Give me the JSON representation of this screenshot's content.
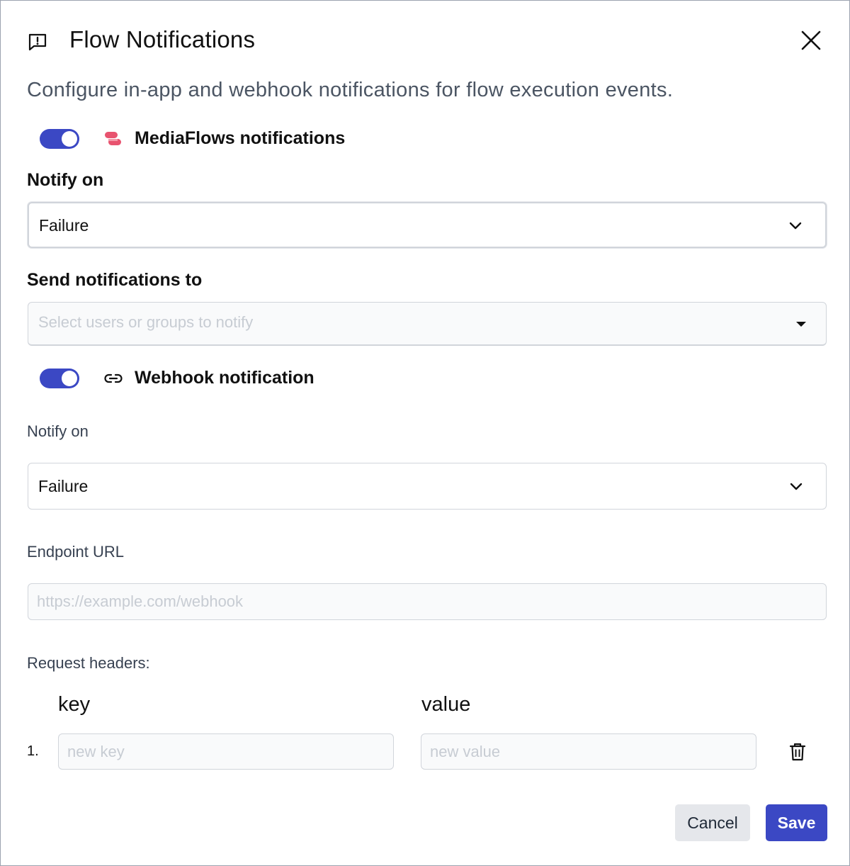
{
  "dialog": {
    "title": "Flow Notifications",
    "description": "Configure in-app and webhook notifications for flow execution events."
  },
  "mediaflows": {
    "enabled": true,
    "title": "MediaFlows notifications",
    "notify_on_label": "Notify on",
    "notify_on_value": "Failure",
    "send_to_label": "Send notifications to",
    "send_to_placeholder": "Select users or groups to notify"
  },
  "webhook": {
    "enabled": true,
    "title": "Webhook notification",
    "notify_on_label": "Notify on",
    "notify_on_value": "Failure",
    "endpoint_label": "Endpoint URL",
    "endpoint_placeholder": "https://example.com/webhook",
    "headers_label": "Request headers:",
    "headers_table": {
      "columns": [
        "key",
        "value"
      ],
      "rows": [
        {
          "index": "1.",
          "key_placeholder": "new key",
          "value_placeholder": "new value"
        }
      ]
    }
  },
  "footer": {
    "cancel_label": "Cancel",
    "save_label": "Save"
  },
  "colors": {
    "accent": "#3b48c4",
    "mediaflows_icon": "#e8536f"
  },
  "icons": {
    "header": "message-alert-icon",
    "close": "close-icon",
    "mediaflows": "mediaflows-logo-icon",
    "webhook": "link-icon",
    "chevron": "chevron-down-icon",
    "caret": "caret-down-icon",
    "delete": "trash-icon"
  }
}
